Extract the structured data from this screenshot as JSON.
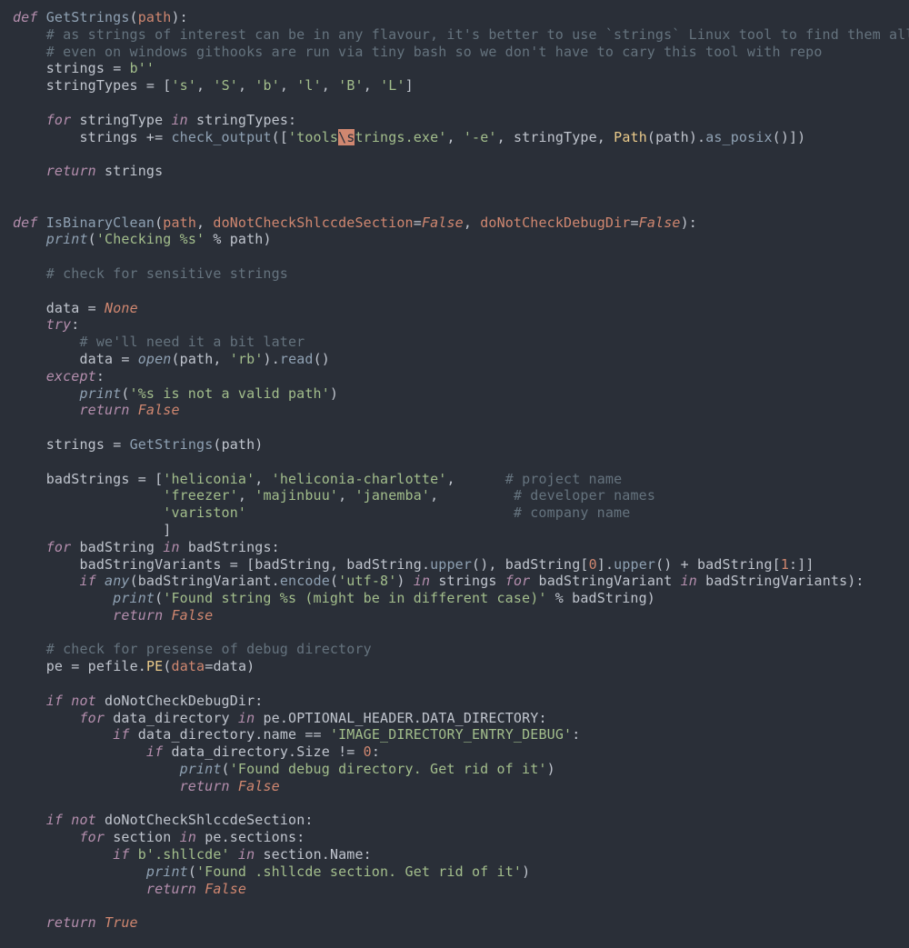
{
  "code": {
    "language": "python",
    "theme": "base16-ocean-dark",
    "functions": [
      {
        "name": "GetStrings",
        "params": [
          "path"
        ],
        "body_lines": [
          "# as strings of interest can be in any flavour, it's better to use `strings` Linux tool to find them all",
          "# even on windows githooks are run via tiny bash so we don't have to cary this tool with repo",
          "strings = b''",
          "stringTypes = ['s', 'S', 'b', 'l', 'B', 'L']",
          "",
          "for stringType in stringTypes:",
          "    strings += check_output(['tools\\strings.exe', '-e', stringType, Path(path).as_posix()])",
          "",
          "return strings"
        ]
      },
      {
        "name": "IsBinaryClean",
        "params": [
          "path",
          "doNotCheckShlccdeSection=False",
          "doNotCheckDebugDir=False"
        ],
        "body_lines": [
          "print('Checking %s' % path)",
          "",
          "# check for sensitive strings",
          "",
          "data = None",
          "try:",
          "    # we'll need it a bit later",
          "    data = open(path, 'rb').read()",
          "except:",
          "    print('%s is not a valid path')",
          "    return False",
          "",
          "strings = GetStrings(path)",
          "",
          "badStrings = ['heliconia', 'heliconia-charlotte',      # project name",
          "              'freezer', 'majinbuu', 'janemba',         # developer names",
          "              'variston'                                # company name",
          "              ]",
          "for badString in badStrings:",
          "    badStringVariants = [badString, badString.upper(), badString[0].upper() + badString[1:]]",
          "    if any(badStringVariant.encode('utf-8') in strings for badStringVariant in badStringVariants):",
          "        print('Found string %s (might be in different case)' % badString)",
          "        return False",
          "",
          "# check for presense of debug directory",
          "pe = pefile.PE(data=data)",
          "",
          "if not doNotCheckDebugDir:",
          "    for data_directory in pe.OPTIONAL_HEADER.DATA_DIRECTORY:",
          "        if data_directory.name == 'IMAGE_DIRECTORY_ENTRY_DEBUG':",
          "            if data_directory.Size != 0:",
          "                print('Found debug directory. Get rid of it')",
          "                return False",
          "",
          "if not doNotCheckShlccdeSection:",
          "    for section in pe.sections:",
          "        if b'.shllcde' in section.Name:",
          "            print('Found .shllcde section. Get rid of it')",
          "            return False",
          "",
          "return True"
        ]
      }
    ],
    "string_literals": [
      "s",
      "S",
      "b",
      "l",
      "B",
      "L",
      "tools\\strings.exe",
      "-e",
      "Checking %s",
      "rb",
      "%s is not a valid path",
      "heliconia",
      "heliconia-charlotte",
      "freezer",
      "majinbuu",
      "janemba",
      "variston",
      "utf-8",
      "Found string %s (might be in different case)",
      "IMAGE_DIRECTORY_ENTRY_DEBUG",
      "Found debug directory. Get rid of it",
      ".shllcde",
      "Found .shllcde section. Get rid of it"
    ],
    "comments": [
      "as strings of interest can be in any flavour, it's better to use `strings` Linux tool to find them all",
      "even on windows githooks are run via tiny bash so we don't have to cary this tool with repo",
      "check for sensitive strings",
      "we'll need it a bit later",
      "project name",
      "developer names",
      "company name",
      "check for presense of debug directory"
    ],
    "highlighted_substring": "\\s",
    "highlighted_context": "tools\\strings.exe"
  }
}
